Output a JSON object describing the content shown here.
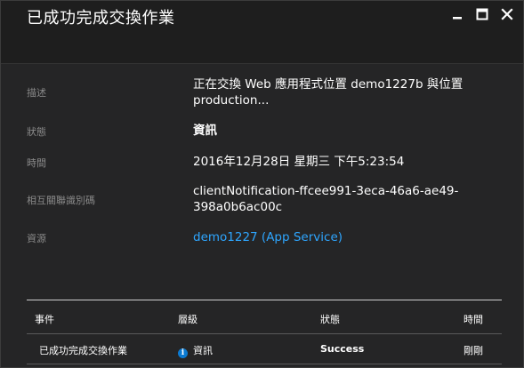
{
  "window": {
    "title": "已成功完成交換作業",
    "controls": {
      "minimize": "minimize",
      "maximize": "maximize",
      "close": "close"
    }
  },
  "details": {
    "description_label": "描述",
    "description_value_line1": "正在交換 Web 應用程式位置 demo1227b 與位置",
    "description_value_line2": "production...",
    "status_label": "狀態",
    "status_value": "資訊",
    "time_label": "時間",
    "time_value": "2016年12月28日 星期三 下午5:23:54",
    "correlation_label": "相互關聯識別碼",
    "correlation_value_line1": "clientNotification-ffcee991-3eca-46a6-ae49-",
    "correlation_value_line2": "398a0b6ac00c",
    "resource_label": "資源",
    "resource_value": "demo1227 (App Service)"
  },
  "events_table": {
    "columns": [
      "事件",
      "層級",
      "狀態",
      "時間"
    ],
    "rows": [
      {
        "event": "已成功完成交換作業",
        "level": "資訊",
        "status": "Success",
        "time": "剛剛"
      }
    ]
  },
  "colors": {
    "background": "#252526",
    "titlebar": "#1e1e1e",
    "label": "#8a8a8a",
    "link": "#2ea6ff",
    "info_icon": "#0b7ad1"
  }
}
